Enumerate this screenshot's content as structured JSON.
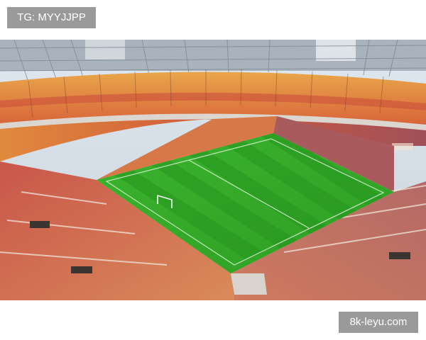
{
  "tag_label": "TG: MYYJJPP",
  "watermark": "8k-leyu.com",
  "photo": {
    "subject": "football stadium",
    "colors": {
      "sky": "#e4ecf2",
      "roof_steel": "#9aa6b2",
      "seat_orange": "#e58a3c",
      "seat_red": "#c8453a",
      "seat_yellow": "#efb24a",
      "pitch_light": "#38b02c",
      "pitch_dark": "#2a9a22"
    }
  }
}
